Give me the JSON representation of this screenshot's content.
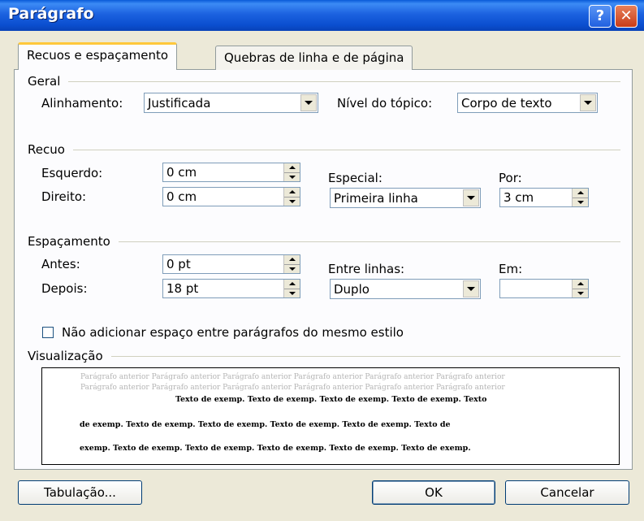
{
  "window": {
    "title": "Parágrafo",
    "help_glyph": "?",
    "close_glyph": "✕"
  },
  "tabs": [
    {
      "label": "Recuos e espaçamento",
      "selected": true
    },
    {
      "label": "Quebras de linha e de página",
      "selected": false
    }
  ],
  "geral": {
    "section_label": "Geral",
    "alinhamento_label": "Alinhamento:",
    "alinhamento_value": "Justificada",
    "nivel_label": "Nível do tópico:",
    "nivel_value": "Corpo de texto"
  },
  "recuo": {
    "section_label": "Recuo",
    "esquerdo_label": "Esquerdo:",
    "esquerdo_value": "0 cm",
    "direito_label": "Direito:",
    "direito_value": "0 cm",
    "especial_label": "Especial:",
    "especial_value": "Primeira linha",
    "por_label": "Por:",
    "por_value": "3 cm"
  },
  "espacamento": {
    "section_label": "Espaçamento",
    "antes_label": "Antes:",
    "antes_value": "0 pt",
    "depois_label": "Depois:",
    "depois_value": "18 pt",
    "entre_linhas_label": "Entre linhas:",
    "entre_linhas_value": "Duplo",
    "em_label": "Em:",
    "em_value": ""
  },
  "checkbox": {
    "label": "Não adicionar espaço entre parágrafos do mesmo estilo",
    "checked": false
  },
  "visualizacao": {
    "section_label": "Visualização",
    "prev_line_1": "Parágrafo anterior Parágrafo anterior Parágrafo anterior Parágrafo anterior Parágrafo anterior Parágrafo anterior",
    "prev_line_2": "Parágrafo anterior Parágrafo anterior Parágrafo anterior Parágrafo anterior Parágrafo anterior Parágrafo anterior",
    "sample_line_1": "Texto de exemp. Texto de exemp. Texto de exemp. Texto de exemp. Texto",
    "sample_line_2": "de exemp. Texto de exemp. Texto de exemp. Texto de exemp. Texto de exemp. Texto de",
    "sample_line_3": "exemp. Texto de exemp. Texto de exemp. Texto de exemp. Texto de exemp. Texto de exemp."
  },
  "buttons": {
    "tabulacao": "Tabulação...",
    "ok": "OK",
    "cancelar": "Cancelar"
  }
}
